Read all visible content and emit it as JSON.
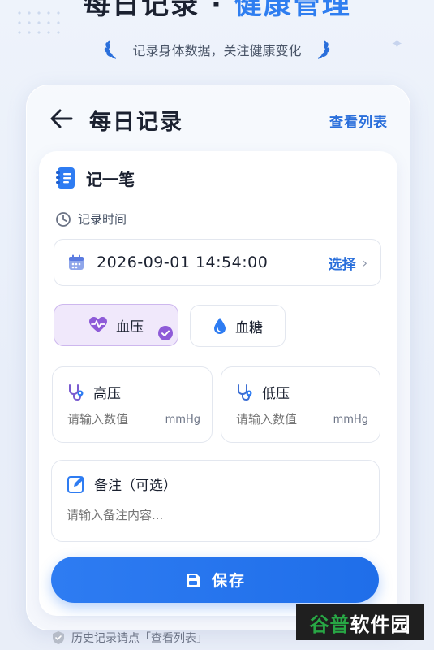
{
  "hero": {
    "title_part1": "每日记录",
    "separator": "·",
    "title_part2": "健康管理",
    "subtitle": "记录身体数据，关注健康变化"
  },
  "header": {
    "title": "每日记录",
    "view_list": "查看列表"
  },
  "form": {
    "section_title": "记一笔",
    "time_label": "记录时间",
    "datetime_value": "2026-09-01 14:54:00",
    "select_label": "选择",
    "types": [
      {
        "label": "血压",
        "selected": true
      },
      {
        "label": "血糖",
        "selected": false
      }
    ],
    "high_label": "高压",
    "low_label": "低压",
    "value_placeholder": "请输入数值",
    "unit": "mmHg",
    "note_label": "备注（可选）",
    "note_placeholder": "请输入备注内容..."
  },
  "save_label": "保存",
  "footer_tip": "历史记录请点「查看列表」",
  "watermark": {
    "part1": "谷普",
    "part2": "软件园"
  },
  "colors": {
    "accent": "#2a6fdb",
    "primary_button": "#2e7cf2",
    "selected_type_bg": "#f0e8fb",
    "purple_icon": "#8e5bd8"
  }
}
